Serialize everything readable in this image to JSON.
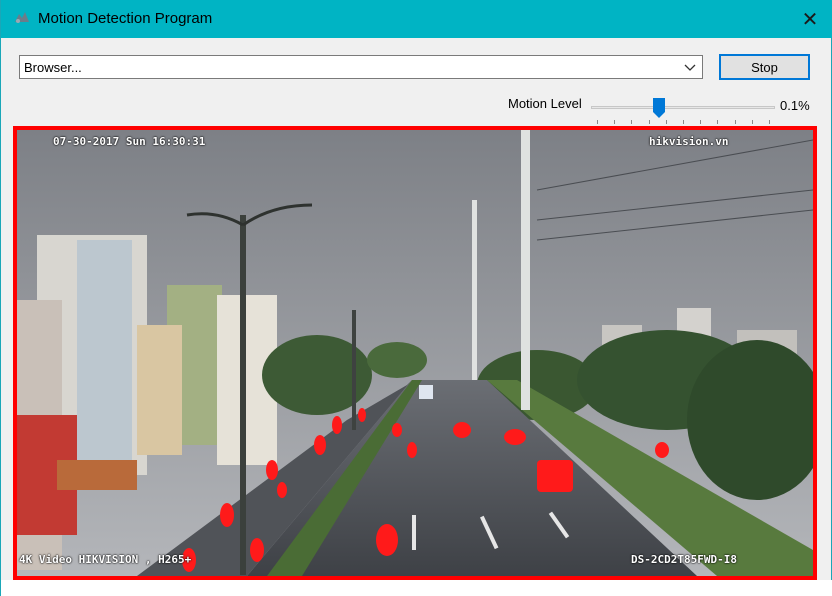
{
  "window": {
    "title": "Motion Detection Program",
    "close_glyph": "✕",
    "accent": "#00b4c4"
  },
  "controls": {
    "source_dropdown_value": "Browser...",
    "stop_label": "Stop",
    "motion_level_label": "Motion Level",
    "motion_level_value": "0.1%",
    "motion_level_fraction": 0.36
  },
  "video": {
    "timestamp": "07-30-2017 Sun 16:30:31",
    "watermark": "hikvision.vn",
    "codec_caption": "4K Video HIKVISION , H265+",
    "model_caption": "DS-2CD2T85FWD-I8",
    "detection_box_color": "#ff0000"
  },
  "icons": {
    "app": "app-logo-icon",
    "close": "close-icon",
    "dropdown": "chevron-down-icon",
    "slider_thumb": "slider-thumb-icon"
  }
}
